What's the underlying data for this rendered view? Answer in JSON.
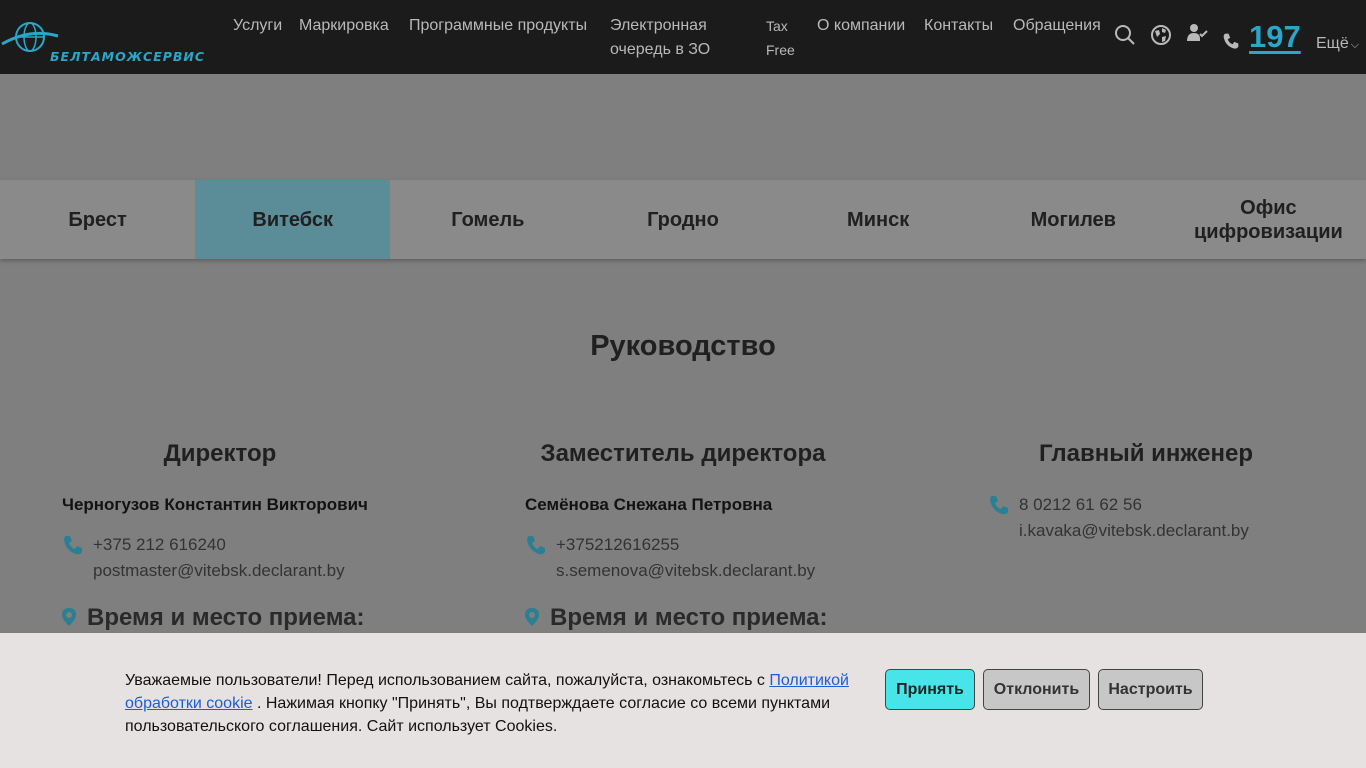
{
  "header": {
    "logo_text": "БЕЛТАМОЖСЕРВИС",
    "nav": [
      {
        "label": "Услуги"
      },
      {
        "label": "Маркировка"
      },
      {
        "label": "Программные продукты"
      },
      {
        "label_line1": "Электронная",
        "label_line2": "очередь в ЗО"
      },
      {
        "label_line1": "Tax",
        "label_line2": "Free"
      },
      {
        "label": "О компании"
      },
      {
        "label": "Контакты"
      },
      {
        "label": "Обращения"
      }
    ],
    "phone_short": "197",
    "more_label": "Ещё",
    "icons": [
      "search-icon",
      "globe-icon",
      "user-check-icon",
      "phone-icon"
    ],
    "accent_color": "#2aa6c8"
  },
  "tabs": [
    {
      "label": "Брест",
      "active": false
    },
    {
      "label": "Витебск",
      "active": true
    },
    {
      "label": "Гомель",
      "active": false
    },
    {
      "label": "Гродно",
      "active": false
    },
    {
      "label": "Минск",
      "active": false
    },
    {
      "label": "Могилев",
      "active": false
    },
    {
      "label": "Офис цифровизации",
      "active": false
    }
  ],
  "section_title": "Руководство",
  "management": [
    {
      "title": "Директор",
      "name": "Черногузов Константин Викторович",
      "phone": "+375 212 616240",
      "email": "postmaster@vitebsk.declarant.by",
      "reception_title": "Время и место приема:"
    },
    {
      "title": "Заместитель директора",
      "name": "Семёнова Снежана Петровна",
      "phone": "+375212616255",
      "email": "s.semenova@vitebsk.declarant.by",
      "reception_title": "Время и место приема:"
    },
    {
      "title": "Главный инженер",
      "name": "",
      "phone": "8 0212 61 62 56",
      "email": "i.kavaka@vitebsk.declarant.by"
    }
  ],
  "cookie": {
    "text_before": "Уважаемые пользователи! Перед использованием сайта, пожалуйста, ознакомьтесь с ",
    "link": "Политикой обработки cookie",
    "text_after": " . Нажимая кнопку \"Принять\", Вы подтверждаете согласие со всеми пунктами пользовательского соглашения. Сайт использует Cookies.",
    "accept": "Принять",
    "decline": "Отклонить",
    "settings": "Настроить"
  }
}
